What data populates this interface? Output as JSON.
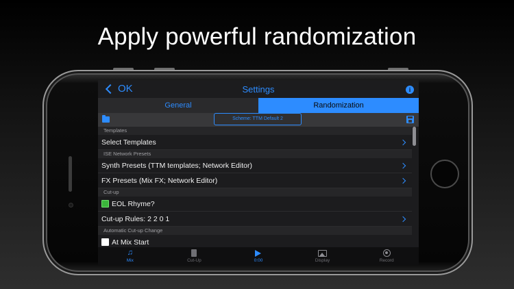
{
  "headline": "Apply powerful randomization",
  "colors": {
    "accent": "#2d8cff",
    "check_on": "#3bb53b"
  },
  "nav": {
    "back_label": "OK",
    "title": "Settings",
    "info_icon": "i"
  },
  "tabs": [
    {
      "label": "General",
      "selected": false
    },
    {
      "label": "Randomization",
      "selected": true
    }
  ],
  "toolbar": {
    "scheme_label": "Scheme: TTM Default 2"
  },
  "sections": {
    "templates": "Templates",
    "ise_network": "ISE Network Presets",
    "cutup": "Cut-up",
    "auto_change": "Automatic Cut-up Change"
  },
  "rows": {
    "select_templates": "Select Templates",
    "synth_presets": "Synth Presets (TTM templates; Network Editor)",
    "fx_presets": "FX Presets (Mix FX; Network Editor)",
    "eol_rhyme": "EOL Rhyme?",
    "cutup_rules": "Cut-up Rules: 2 2 0 1",
    "at_mix_start": "At Mix Start"
  },
  "checks": {
    "eol_rhyme": true,
    "at_mix_start": false
  },
  "bottombar": [
    {
      "label": "Mix",
      "icon": "music-note-icon",
      "active": true
    },
    {
      "label": "Cut-Up",
      "icon": "document-icon",
      "active": false
    },
    {
      "label": "0:00",
      "icon": "play-icon",
      "active": true
    },
    {
      "label": "Display",
      "icon": "image-icon",
      "active": false
    },
    {
      "label": "Record",
      "icon": "record-icon",
      "active": false
    }
  ]
}
